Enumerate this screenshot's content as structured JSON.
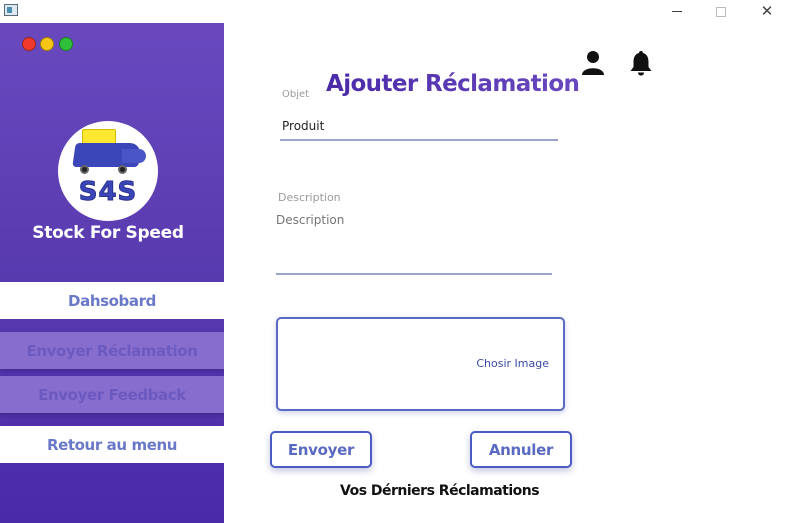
{
  "window": {
    "min_symbol": "—",
    "max_symbol": "☐",
    "close_symbol": "✕"
  },
  "sidebar": {
    "logo_text": "S4S",
    "brand": "Stock For Speed",
    "items": [
      {
        "label": "Dahsobard"
      },
      {
        "label": "Envoyer Réclamation"
      },
      {
        "label": "Envoyer Feedback"
      },
      {
        "label": "Retour au menu"
      }
    ]
  },
  "header": {
    "icons": [
      "user-icon",
      "bell-icon"
    ]
  },
  "main": {
    "title": "Ajouter Réclamation",
    "objet": {
      "label": "Objet",
      "value": "Produit"
    },
    "description": {
      "placeholder": "Description",
      "value": ""
    },
    "image": {
      "button_label": "Chosir Image"
    },
    "buttons": {
      "send": "Envoyer",
      "cancel": "Annuler"
    },
    "recent_title": "Vos Dérniers Réclamations"
  },
  "colors": {
    "sidebar_top": "#6a49bf",
    "sidebar_bottom": "#4a2aa8",
    "accent": "#4a5cc4",
    "nav_text": "#6a78c8"
  }
}
